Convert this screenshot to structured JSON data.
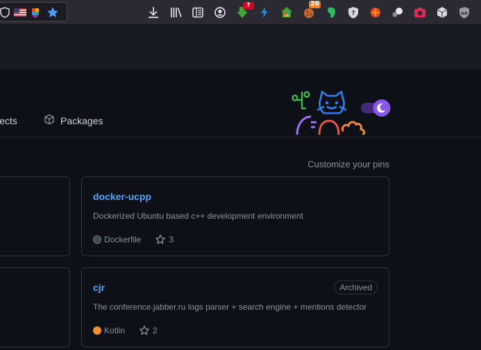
{
  "toolbar": {
    "icons": [
      "shield-icon",
      "us-flag-icon",
      "colorful-extension-icon",
      "bookmark-star-icon",
      "download-icon",
      "library-icon",
      "reader-view-icon",
      "account-icon",
      "download-helper-icon",
      "lightning-extension-icon",
      "house-extension-icon",
      "cookie-extension-icon",
      "evernote-icon",
      "privacy-badger-icon",
      "bug-extension-icon",
      "extension-icon",
      "screenshot-icon",
      "cube-extension-icon",
      "ublock-icon"
    ],
    "badges": {
      "download_helper": "?",
      "cookie": "26"
    },
    "badge_colors": {
      "download_helper": "#d70022",
      "cookie": "#e8842a"
    }
  },
  "tabs": [
    {
      "label": "jects",
      "icon": "project-icon"
    },
    {
      "label": "Packages",
      "icon": "package-icon"
    }
  ],
  "pins": {
    "customize_label": "Customize your pins",
    "cards": [
      {
        "name": "docker-ucpp",
        "description": "Dockerized Ubuntu based c++ development environment",
        "language": "Dockerfile",
        "language_color": "#384d54",
        "stars": "3",
        "archived": ""
      },
      {
        "name": "cjr",
        "description": "The conference.jabber.ru logs parser + search engine + mentions detector",
        "language": "Kotlin",
        "language_color": "#F18E33",
        "stars": "2",
        "archived": "Archived"
      }
    ]
  },
  "theme_toggle": {
    "icon": "moon-icon",
    "color": "#6e40c9"
  }
}
